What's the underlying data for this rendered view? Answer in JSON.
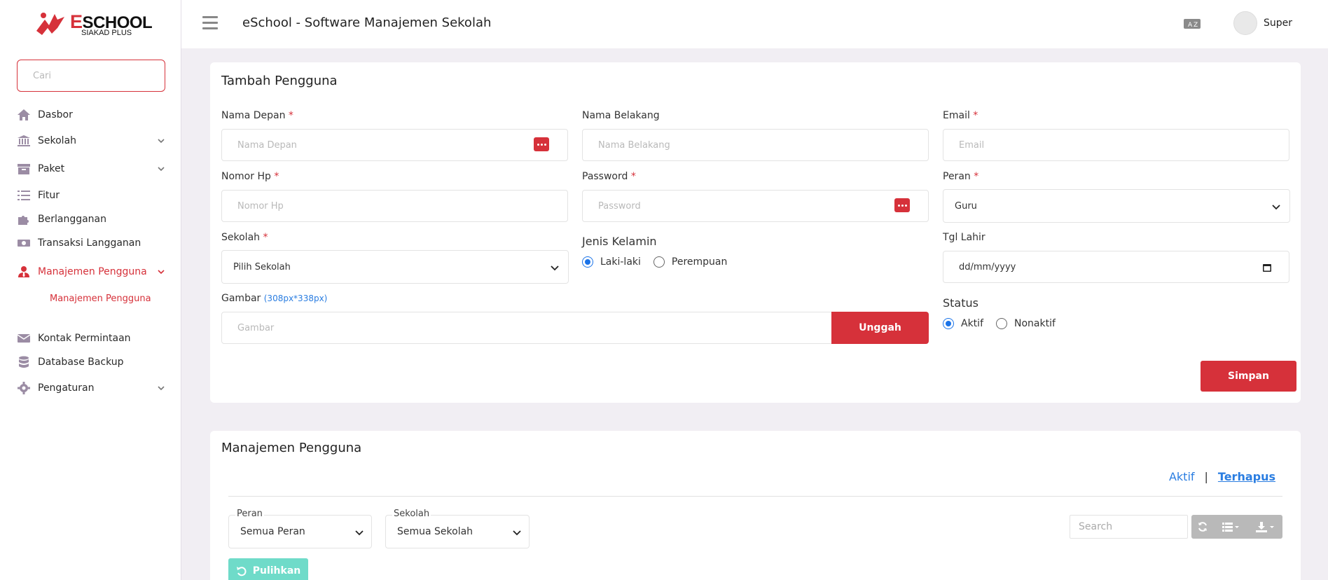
{
  "brand": {
    "name_first": "E",
    "name_rest": "SCHOOL",
    "subtitle": "SIAKAD PLUS",
    "accent": "#d6313a"
  },
  "sidebar": {
    "search_placeholder": "Cari",
    "items": [
      {
        "label": "Dasbor",
        "icon": "home-icon",
        "expandable": false
      },
      {
        "label": "Sekolah",
        "icon": "school-building-icon",
        "expandable": true
      },
      {
        "label": "Paket",
        "icon": "archive-box-icon",
        "expandable": true
      },
      {
        "label": "Fitur",
        "icon": "list-icon",
        "expandable": false
      },
      {
        "label": "Berlangganan",
        "icon": "puzzle-icon",
        "expandable": false
      },
      {
        "label": "Transaksi Langganan",
        "icon": "money-icon",
        "expandable": false
      },
      {
        "label": "Manajemen Pengguna",
        "icon": "user-tie-icon",
        "expandable": true,
        "active": true
      },
      {
        "label": "Kontak Permintaan",
        "icon": "envelope-icon",
        "expandable": false
      },
      {
        "label": "Database Backup",
        "icon": "database-icon",
        "expandable": false
      },
      {
        "label": "Pengaturan",
        "icon": "gear-icon",
        "expandable": true
      }
    ],
    "sub_item": "Manajemen Pengguna"
  },
  "header": {
    "title": "eSchool - Software Manajemen Sekolah",
    "user_name": "Super"
  },
  "form": {
    "title": "Tambah Pengguna",
    "first_name": {
      "label": "Nama Depan",
      "required": "*",
      "placeholder": "Nama Depan"
    },
    "last_name": {
      "label": "Nama Belakang",
      "placeholder": "Nama Belakang"
    },
    "email": {
      "label": "Email",
      "required": "*",
      "placeholder": "Email"
    },
    "phone": {
      "label": "Nomor Hp",
      "required": "*",
      "placeholder": "Nomor Hp"
    },
    "password": {
      "label": "Password",
      "required": "*",
      "placeholder": "Password"
    },
    "role": {
      "label": "Peran",
      "required": "*",
      "value": "Guru"
    },
    "school": {
      "label": "Sekolah",
      "required": "*",
      "value": "Pilih Sekolah"
    },
    "gender": {
      "label": "Jenis Kelamin",
      "options": [
        "Laki-laki",
        "Perempuan"
      ],
      "selected": "Laki-laki"
    },
    "birth_date": {
      "label": "Tgl Lahir",
      "value": "dd/mm/yyyy"
    },
    "image": {
      "label": "Gambar",
      "hint": "(308px*338px)",
      "placeholder": "Gambar",
      "upload_label": "Unggah"
    },
    "status": {
      "label": "Status",
      "options": [
        "Aktif",
        "Nonaktif"
      ],
      "selected": "Aktif"
    },
    "save_label": "Simpan"
  },
  "list": {
    "title": "Manajemen Pengguna",
    "tab_active": "Aktif",
    "tab_separator": "|",
    "tab_deleted": "Terhapus",
    "filter_role": {
      "label": "Peran",
      "value": "Semua Peran"
    },
    "filter_school": {
      "label": "Sekolah",
      "value": "Semua Sekolah"
    },
    "search_placeholder": "Search",
    "restore_label": "Pulihkan",
    "restore_color": "#6fdbc9"
  }
}
